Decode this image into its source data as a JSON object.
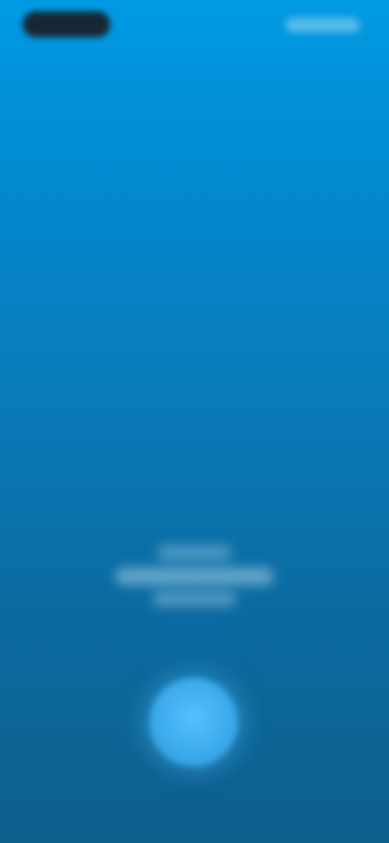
{
  "status_bar": {
    "time": "",
    "icons": [
      "signal-icon",
      "wifi-icon",
      "battery-icon"
    ]
  },
  "caption": {
    "lines": [
      "",
      "",
      ""
    ]
  },
  "colors": {
    "background_top": "#009ae3",
    "background_bottom": "#0d5f8c",
    "action_button": "#4ab8f5",
    "status_pill": "#1a1f24"
  }
}
